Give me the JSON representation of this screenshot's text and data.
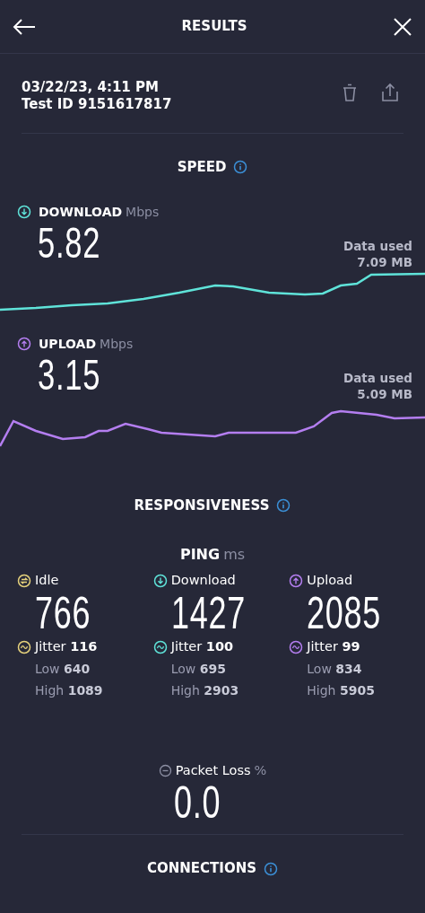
{
  "header": {
    "title": "RESULTS"
  },
  "test": {
    "datetime": "03/22/23, 4:11 PM",
    "test_id": "Test ID 9151617817"
  },
  "speed": {
    "title": "SPEED",
    "metrics": [
      {
        "kind": "download",
        "label": "DOWNLOAD",
        "unit": "Mbps",
        "value": "5.82",
        "data_used_label": "Data used",
        "data_used": "7.09 MB",
        "color": "#5fe3d9"
      },
      {
        "kind": "upload",
        "label": "UPLOAD",
        "unit": "Mbps",
        "value": "3.15",
        "data_used_label": "Data used",
        "data_used": "5.09 MB",
        "color": "#b47ef0"
      }
    ]
  },
  "responsiveness": {
    "title": "RESPONSIVENESS",
    "ping": {
      "label": "PING",
      "unit": "ms"
    },
    "columns": [
      {
        "kind": "idle",
        "label": "Idle",
        "value": "766",
        "jitter": "Jitter **116**",
        "low": "Low **640**",
        "high": "High **1089**",
        "color": "#e6d27c"
      },
      {
        "kind": "download",
        "label": "Download",
        "value": "1427",
        "jitter": "Jitter **100**",
        "low": "Low **695**",
        "high": "High **2903**",
        "color": "#5fe3d9"
      },
      {
        "kind": "upload",
        "label": "Upload",
        "value": "2085",
        "jitter": "Jitter **99**",
        "low": "Low **834**",
        "high": "High **5905**",
        "color": "#b47ef0"
      }
    ]
  },
  "packet_loss": {
    "label": "Packet Loss",
    "unit": "%",
    "value": "0.0"
  },
  "connections": {
    "title": "CONNECTIONS"
  }
}
